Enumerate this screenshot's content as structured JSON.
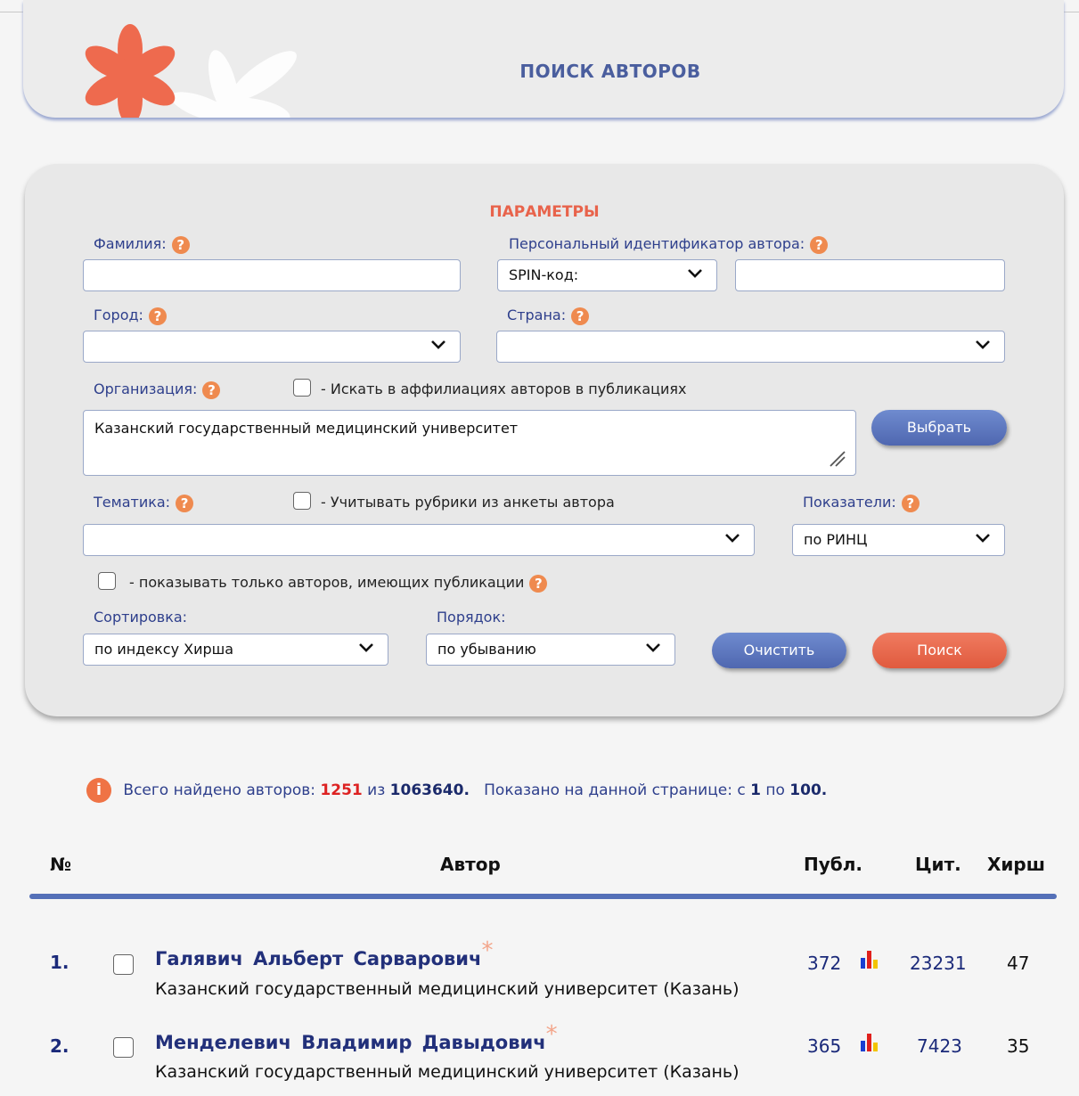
{
  "header": {
    "title": "ПОИСК АВТОРОВ"
  },
  "params": {
    "title": "ПАРАМЕТРЫ",
    "surname_label": "Фамилия:",
    "personal_id_label": "Персональный идентификатор автора:",
    "id_type_value": "SPIN-код:",
    "city_label": "Город:",
    "country_label": "Страна:",
    "org_label": "Организация:",
    "search_affiliations_label": "- Искать в аффилиациях авторов в публикациях",
    "org_value": "Казанский государственный медицинский университет",
    "choose_button": "Выбрать",
    "topic_label": "Тематика:",
    "topic_rubrics_label": "- Учитывать рубрики из анкеты автора",
    "indicators_label": "Показатели:",
    "indicators_value": "по РИНЦ",
    "only_with_pubs_label": "- показывать только авторов, имеющих публикации",
    "sort_label": "Сортировка:",
    "sort_value": "по индексу Хирша",
    "order_label": "Порядок:",
    "order_value": "по убыванию",
    "clear_button": "Очистить",
    "search_button": "Поиск",
    "help_glyph": "?"
  },
  "summary": {
    "text1": "Всего найдено авторов:",
    "found": "1251",
    "text2": "из",
    "total": "1063640.",
    "text3": "Показано на данной странице: с",
    "from": "1",
    "text4": "по",
    "to": "100."
  },
  "table": {
    "headers": {
      "num": "№",
      "author": "Автор",
      "pubs": "Публ.",
      "cites": "Цит.",
      "hirsch": "Хирш"
    },
    "rows": [
      {
        "num": "1.",
        "name": "Галявич Альберт Сарварович",
        "org": "Казанский государственный медицинский университет (Казань)",
        "pubs": "372",
        "cites": "23231",
        "hirsch": "47"
      },
      {
        "num": "2.",
        "name": "Менделевич Владимир Давыдович",
        "org": "Казанский государственный медицинский университет (Казань)",
        "pubs": "365",
        "cites": "7423",
        "hirsch": "35"
      }
    ]
  },
  "colors": {
    "accent_orange": "#e8634b",
    "link_blue": "#2e3f8c",
    "button_blue": "#5a73bd",
    "button_red": "#e9664b"
  }
}
